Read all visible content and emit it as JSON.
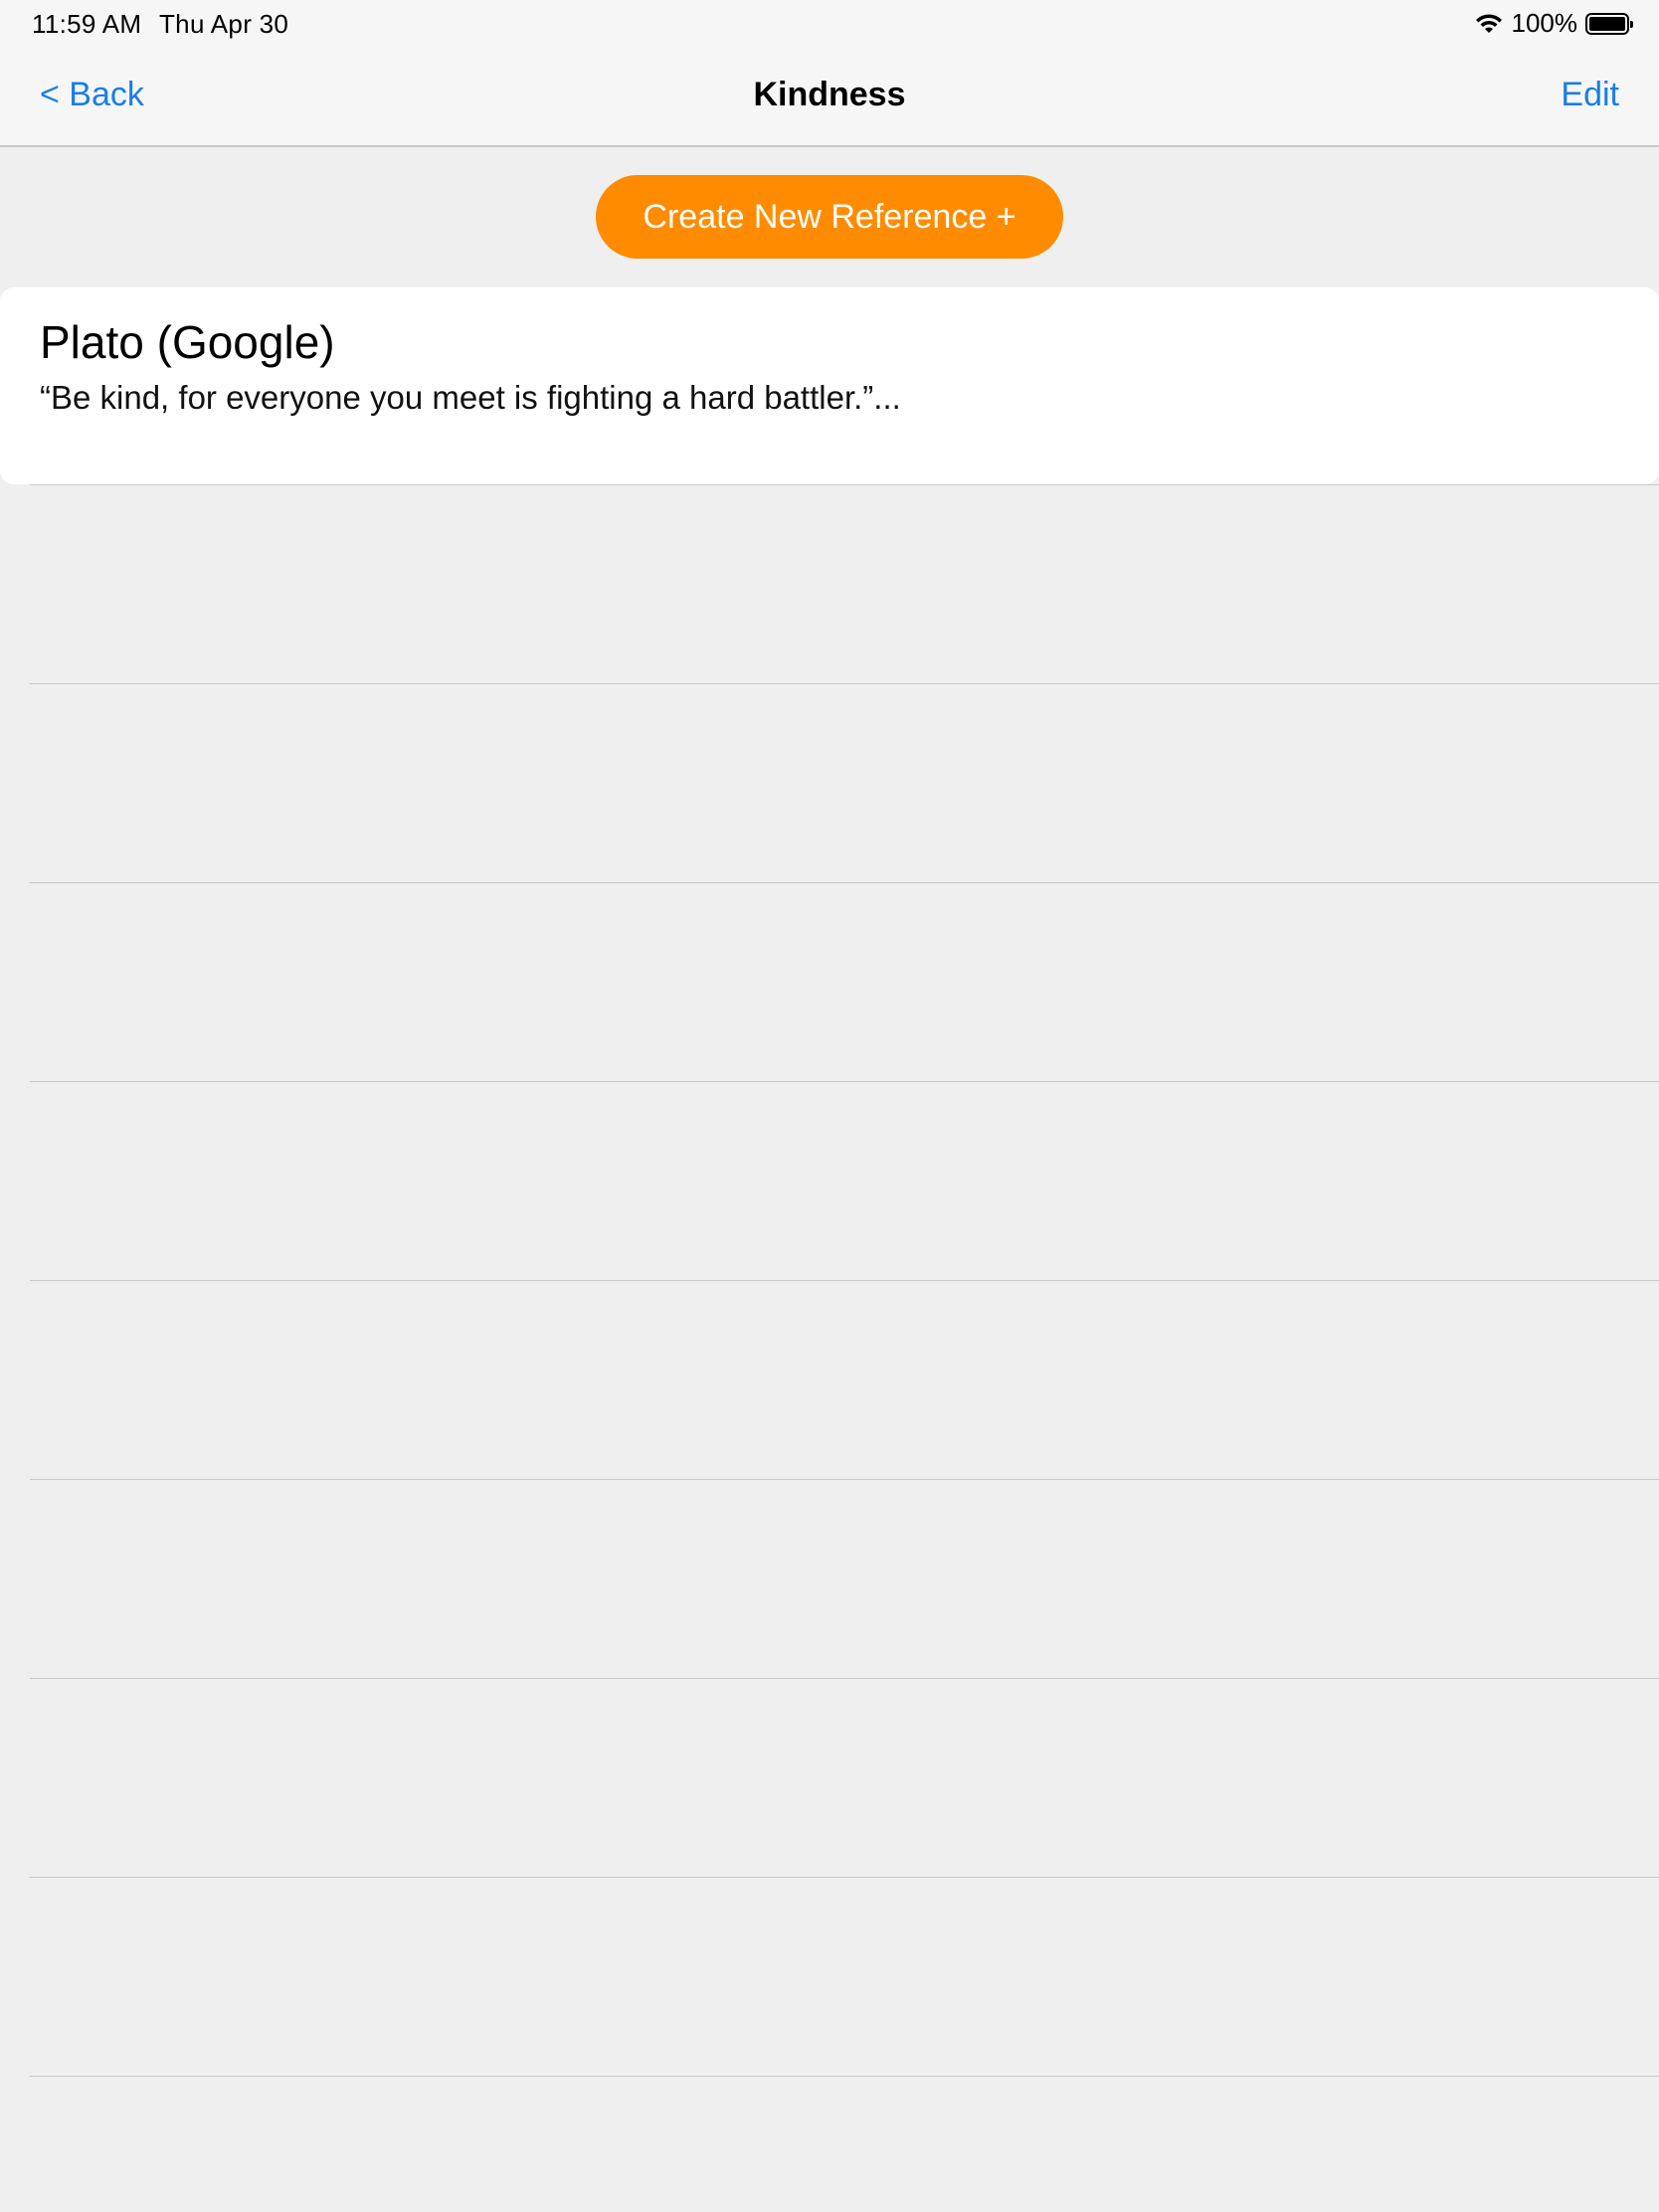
{
  "status_bar": {
    "time": "11:59 AM",
    "date": "Thu Apr 30",
    "battery_percent": "100%",
    "battery_level": 1.0,
    "icons": [
      "wifi-icon",
      "battery-icon"
    ]
  },
  "nav": {
    "back_label": "< Back",
    "title": "Kindness",
    "edit_label": "Edit",
    "accent_color": "#1a7ee6"
  },
  "create_button": {
    "label": "Create New Reference +",
    "color": "#ff8c00"
  },
  "references": [
    {
      "title": "Plato (Google)",
      "quote": "“Be kind, for everyone you meet is fighting a hard battler.”..."
    }
  ],
  "empty_rows": 9
}
